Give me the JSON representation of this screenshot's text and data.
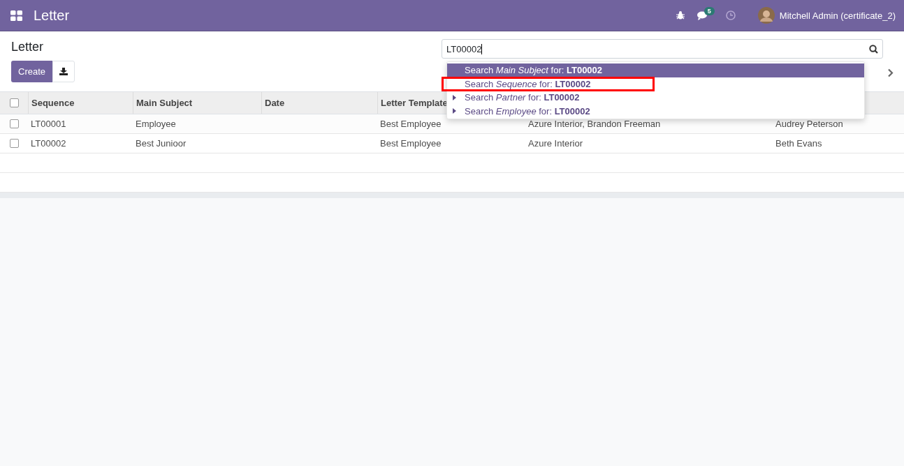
{
  "navbar": {
    "app_title": "Letter",
    "messages_badge": "5",
    "user_name": "Mitchell Admin (certificate_2)"
  },
  "control_panel": {
    "breadcrumb": "Letter",
    "create_button": "Create"
  },
  "search": {
    "value": "LT00002",
    "suggestions": [
      {
        "text": "Search *Main Subject* for: **LT00002**",
        "selected": true,
        "expandable": false,
        "highlighted": false
      },
      {
        "text": "Search *Sequence* for: **LT00002**",
        "selected": false,
        "expandable": false,
        "highlighted": true
      },
      {
        "text": "Search *Partner* for: **LT00002**",
        "selected": false,
        "expandable": true,
        "highlighted": false
      },
      {
        "text": "Search *Employee* for: **LT00002**",
        "selected": false,
        "expandable": true,
        "highlighted": false
      }
    ]
  },
  "table": {
    "header_checked": false,
    "columns": [
      "Sequence",
      "Main Subject",
      "Date",
      "Letter Template"
    ],
    "rows": [
      {
        "checked": false,
        "cells": [
          "LT00001",
          "Employee",
          "",
          "Best Employee",
          "Azure Interior, Brandon Freeman",
          "Audrey Peterson"
        ]
      },
      {
        "checked": false,
        "cells": [
          "LT00002",
          "Best Junioor",
          "",
          "Best Employee",
          "Azure Interior",
          "Beth Evans"
        ]
      }
    ]
  }
}
